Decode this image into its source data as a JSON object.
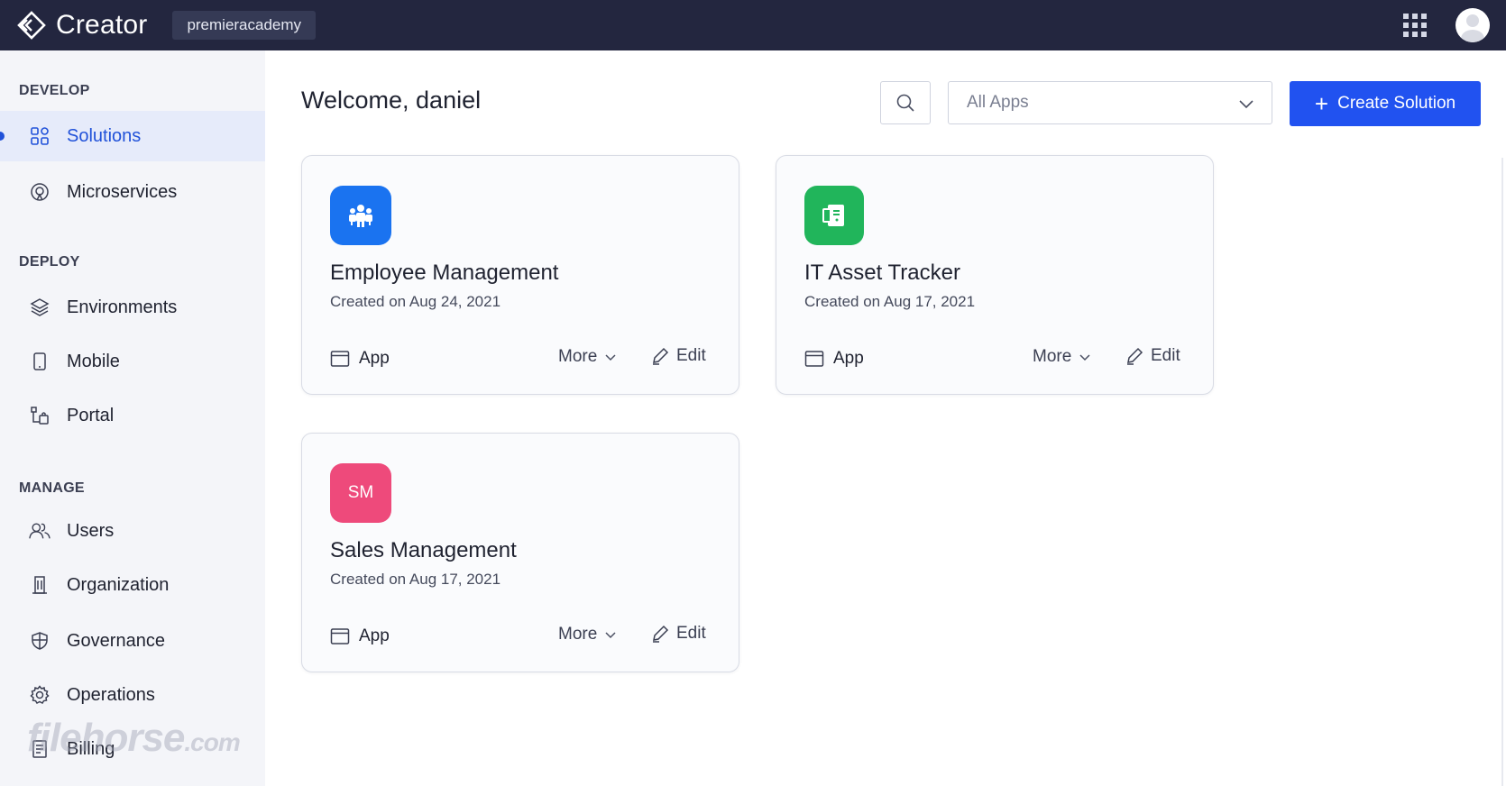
{
  "app": {
    "name": "Creator",
    "org": "premieracademy"
  },
  "sidebar": {
    "sections": [
      {
        "title": "DEVELOP",
        "items": [
          {
            "label": "Solutions",
            "icon": "grid-icon",
            "active": true
          },
          {
            "label": "Microservices",
            "icon": "microservices-icon"
          }
        ]
      },
      {
        "title": "DEPLOY",
        "items": [
          {
            "label": "Environments",
            "icon": "layers-icon"
          },
          {
            "label": "Mobile",
            "icon": "mobile-icon"
          },
          {
            "label": "Portal",
            "icon": "portal-icon"
          }
        ]
      },
      {
        "title": "MANAGE",
        "items": [
          {
            "label": "Users",
            "icon": "users-icon"
          },
          {
            "label": "Organization",
            "icon": "building-icon"
          },
          {
            "label": "Governance",
            "icon": "shield-icon"
          },
          {
            "label": "Operations",
            "icon": "gear-icon"
          },
          {
            "label": "Billing",
            "icon": "billing-icon"
          }
        ]
      }
    ]
  },
  "main": {
    "welcome": "Welcome, daniel",
    "filter": {
      "selected": "All Apps"
    },
    "create_label": "Create Solution",
    "cards": [
      {
        "name": "Employee Management",
        "created": "Created on Aug 24, 2021",
        "icon": "people-icon",
        "color": "#1a73f0",
        "app_label": "App",
        "more_label": "More",
        "edit_label": "Edit"
      },
      {
        "name": "IT Asset Tracker",
        "created": "Created on Aug 17, 2021",
        "icon": "asset-icon",
        "color": "#21b55b",
        "app_label": "App",
        "more_label": "More",
        "edit_label": "Edit"
      },
      {
        "name": "Sales Management",
        "created": "Created on Aug 17, 2021",
        "icon_text": "SM",
        "color": "#ee4a7b",
        "app_label": "App",
        "more_label": "More",
        "edit_label": "Edit"
      }
    ]
  },
  "watermark": {
    "text": "filehorse",
    "suffix": ".com"
  },
  "colors": {
    "topbar": "#23263f",
    "accent": "#2152f0",
    "active_bg": "#e6ebfa"
  }
}
